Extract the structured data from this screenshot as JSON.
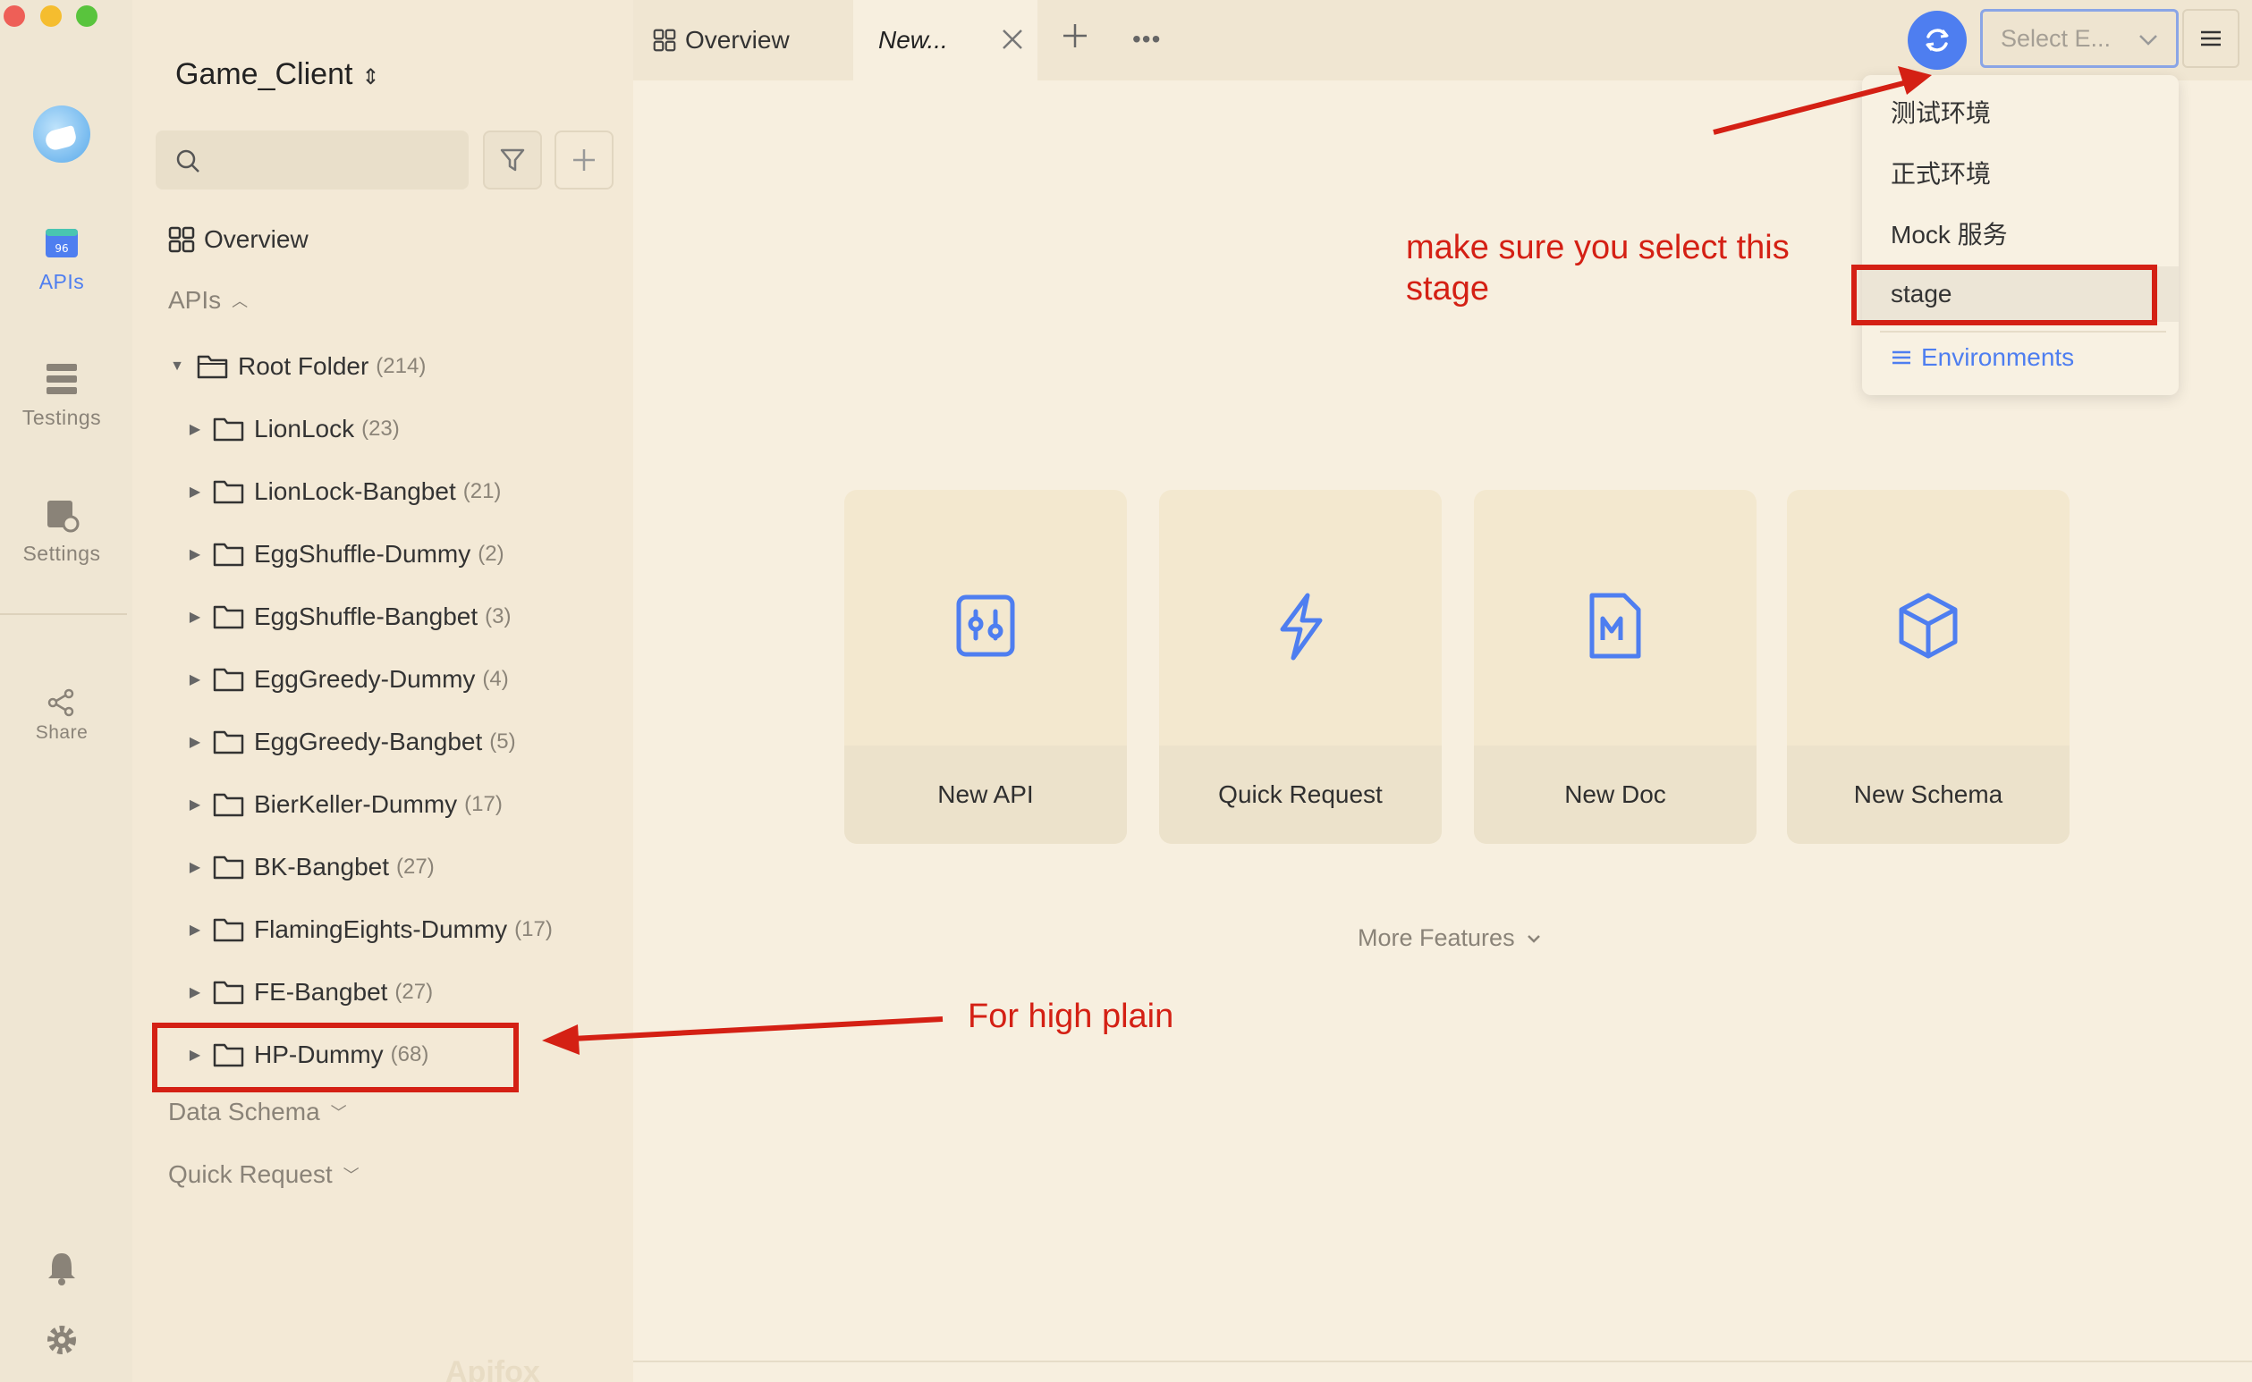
{
  "rail": {
    "items": [
      {
        "label": "APIs",
        "active": true
      },
      {
        "label": "Testings",
        "active": false
      },
      {
        "label": "Settings",
        "active": false
      },
      {
        "label": "Share",
        "active": false
      }
    ]
  },
  "sidebar": {
    "project_title": "Game_Client",
    "search_placeholder": "",
    "overview_label": "Overview",
    "apis_section": "APIs",
    "root_folder": {
      "name": "Root Folder",
      "count": "(214)"
    },
    "folders": [
      {
        "name": "LionLock",
        "count": "(23)"
      },
      {
        "name": "LionLock-Bangbet",
        "count": "(21)"
      },
      {
        "name": "EggShuffle-Dummy",
        "count": "(2)"
      },
      {
        "name": "EggShuffle-Bangbet",
        "count": "(3)"
      },
      {
        "name": "EggGreedy-Dummy",
        "count": "(4)"
      },
      {
        "name": "EggGreedy-Bangbet",
        "count": "(5)"
      },
      {
        "name": "BierKeller-Dummy",
        "count": "(17)"
      },
      {
        "name": "BK-Bangbet",
        "count": "(27)"
      },
      {
        "name": "FlamingEights-Dummy",
        "count": "(17)"
      },
      {
        "name": "FE-Bangbet",
        "count": "(27)"
      },
      {
        "name": "HP-Dummy",
        "count": "(68)"
      }
    ],
    "data_schema_label": "Data Schema",
    "quick_request_label": "Quick Request",
    "watermark": "Apifox"
  },
  "tabs": {
    "overview_label": "Overview",
    "new_tab_label": "New..."
  },
  "env": {
    "select_placeholder": "Select E...",
    "options": [
      "测试环境",
      "正式环境",
      "Mock 服务",
      "stage"
    ],
    "selected": "stage",
    "manage_label": "Environments"
  },
  "cards": [
    {
      "label": "New API",
      "icon": "api-icon"
    },
    {
      "label": "Quick Request",
      "icon": "lightning-icon"
    },
    {
      "label": "New Doc",
      "icon": "markdown-doc-icon"
    },
    {
      "label": "New Schema",
      "icon": "cube-icon"
    }
  ],
  "more_features_label": "More Features",
  "annotations": {
    "stage_note": "make sure you select this stage",
    "hp_note": "For high plain"
  },
  "colors": {
    "accent": "#4e7ef0",
    "annotation_red": "#d42014",
    "background": "#f7efdf"
  }
}
